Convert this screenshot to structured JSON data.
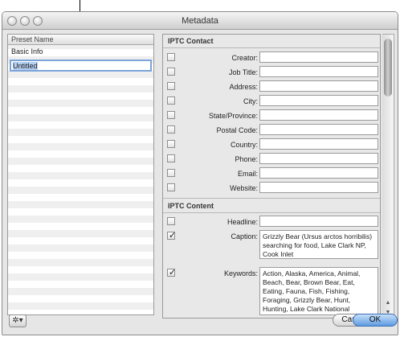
{
  "window": {
    "title": "Metadata"
  },
  "presets": {
    "header": "Preset Name",
    "items": [
      {
        "label": "Basic Info",
        "editing": false
      },
      {
        "label": "Untitled",
        "editing": true
      }
    ]
  },
  "iptc_contact": {
    "title": "IPTC Contact",
    "fields": [
      {
        "label": "Creator:",
        "value": ""
      },
      {
        "label": "Job Title:",
        "value": ""
      },
      {
        "label": "Address:",
        "value": ""
      },
      {
        "label": "City:",
        "value": ""
      },
      {
        "label": "State/Province:",
        "value": ""
      },
      {
        "label": "Postal Code:",
        "value": ""
      },
      {
        "label": "Country:",
        "value": ""
      },
      {
        "label": "Phone:",
        "value": ""
      },
      {
        "label": "Email:",
        "value": ""
      },
      {
        "label": "Website:",
        "value": ""
      }
    ]
  },
  "iptc_content": {
    "title": "IPTC Content",
    "headline": {
      "label": "Headline:",
      "value": "",
      "checked": false
    },
    "caption": {
      "label": "Caption:",
      "value": "Grizzly Bear (Ursus arctos horribilis) searching for food, Lake Clark NP, Cook Inlet",
      "checked": true
    },
    "keywords": {
      "label": "Keywords:",
      "value": "Action, Alaska, America, Animal, Beach, Bear, Brown Bear, Eat, Eating, Fauna, Fish, Fishing, Foraging, Grizzly Bear, Hunt, Hunting, Lake Clark National",
      "checked": true
    }
  },
  "buttons": {
    "cancel": "Cancel",
    "ok": "OK",
    "gear": "✲▾"
  },
  "scroll_arrows": {
    "up": "▲",
    "down": "▼"
  }
}
